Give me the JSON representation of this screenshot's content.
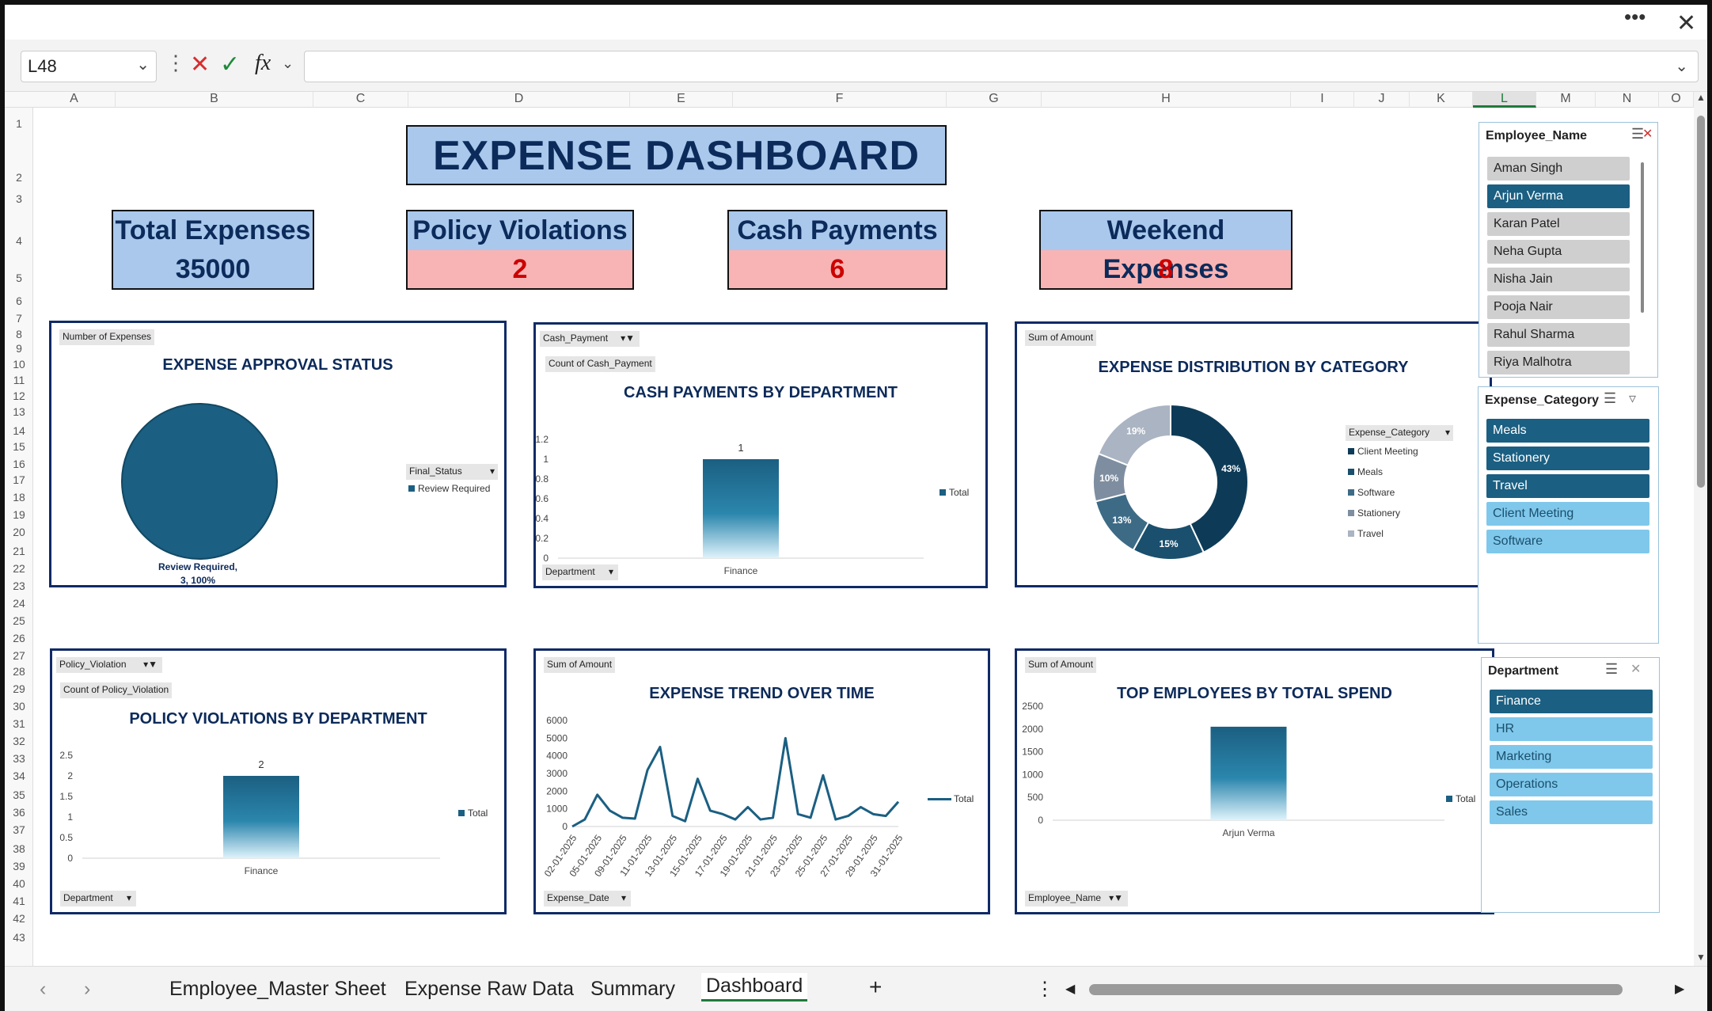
{
  "window": {
    "more": "•••",
    "close": "✕"
  },
  "formula_bar": {
    "name_box": "L48",
    "formula": "",
    "fx": "fx"
  },
  "columns": [
    "A",
    "B",
    "C",
    "D",
    "E",
    "F",
    "G",
    "H",
    "I",
    "J",
    "K",
    "L",
    "M",
    "N",
    "O"
  ],
  "selected_column": "L",
  "rows": [
    "1",
    "2",
    "3",
    "4",
    "5",
    "6",
    "7",
    "8",
    "9",
    "10",
    "11",
    "12",
    "13",
    "14",
    "15",
    "16",
    "17",
    "18",
    "19",
    "20",
    "21",
    "22",
    "23",
    "24",
    "25",
    "26",
    "27",
    "28",
    "29",
    "30",
    "31",
    "32",
    "33",
    "34",
    "35",
    "36",
    "37",
    "38",
    "39",
    "40",
    "41",
    "42",
    "43"
  ],
  "dashboard": {
    "title": "EXPENSE DASHBOARD",
    "kpis": [
      {
        "label": "Total Expenses",
        "value": "35000"
      },
      {
        "label": "Policy Violations",
        "value": "2"
      },
      {
        "label": "Cash Payments",
        "value": "6"
      },
      {
        "label": "Weekend Expenses",
        "value": "8"
      }
    ],
    "colors": {
      "primary": "#1b5f82",
      "title_fill": "#a9c8ec",
      "kpi_value_fill": "#f8b4b4",
      "kpi_value_text": "#cc0000",
      "card_border": "#0f2a66"
    }
  },
  "chart_data": [
    {
      "type": "pie",
      "title": "EXPENSE APPROVAL STATUS",
      "value_field": "Number of Expenses",
      "legend_field": "Final_Status",
      "legend_position": "right",
      "slices": [
        {
          "label": "Review Required",
          "value": 3,
          "percent": "100%"
        }
      ],
      "data_label": "Review Required,\n3, 100%"
    },
    {
      "type": "bar",
      "title": "CASH PAYMENTS BY DEPARTMENT",
      "filter_field": "Cash_Payment",
      "value_field": "Count of Cash_Payment",
      "axis_field": "Department",
      "categories": [
        "Finance"
      ],
      "series": [
        {
          "name": "Total",
          "values": [
            1
          ]
        }
      ],
      "yticks": [
        "0",
        "0.2",
        "0.4",
        "0.6",
        "0.8",
        "1",
        "1.2"
      ],
      "ylim": [
        0,
        1.2
      ],
      "data_labels": [
        "1"
      ],
      "legend_position": "right"
    },
    {
      "type": "pie",
      "title": "EXPENSE DISTRIBUTION BY CATEGORY",
      "value_field": "Sum of Amount",
      "legend_field": "Expense_Category",
      "legend_position": "right",
      "slices": [
        {
          "label": "Client Meeting",
          "percent": 43,
          "text": "43%",
          "color": "#0d3b57"
        },
        {
          "label": "Meals",
          "percent": 15,
          "text": "15%",
          "color": "#1a4f6d"
        },
        {
          "label": "Software",
          "percent": 13,
          "text": "13%",
          "color": "#3d6b86"
        },
        {
          "label": "Stationery",
          "percent": 10,
          "text": "10%",
          "color": "#7e8ea0"
        },
        {
          "label": "Travel",
          "percent": 19,
          "text": "19%",
          "color": "#aab4c2"
        }
      ]
    },
    {
      "type": "bar",
      "title": "POLICY VIOLATIONS BY DEPARTMENT",
      "filter_field": "Policy_Violation",
      "value_field": "Count of Policy_Violation",
      "axis_field": "Department",
      "categories": [
        "Finance"
      ],
      "series": [
        {
          "name": "Total",
          "values": [
            2
          ]
        }
      ],
      "yticks": [
        "0",
        "0.5",
        "1",
        "1.5",
        "2",
        "2.5"
      ],
      "ylim": [
        0,
        2.5
      ],
      "data_labels": [
        "2"
      ],
      "legend_position": "right"
    },
    {
      "type": "line",
      "title": "EXPENSE TREND OVER TIME",
      "value_field": "Sum of Amount",
      "axis_field": "Expense_Date",
      "x_labels": [
        "02-01-2025",
        "05-01-2025",
        "09-01-2025",
        "11-01-2025",
        "13-01-2025",
        "15-01-2025",
        "17-01-2025",
        "19-01-2025",
        "21-01-2025",
        "23-01-2025",
        "25-01-2025",
        "27-01-2025",
        "29-01-2025",
        "31-01-2025"
      ],
      "series": [
        {
          "name": "Total",
          "values": [
            0,
            400,
            1800,
            900,
            500,
            450,
            3200,
            4500,
            600,
            300,
            2700,
            900,
            700,
            400,
            1100,
            400,
            500,
            5000,
            700,
            500,
            2900,
            400,
            600,
            1100,
            700,
            600,
            1400
          ]
        }
      ],
      "yticks": [
        "0",
        "1000",
        "2000",
        "3000",
        "4000",
        "5000",
        "6000"
      ],
      "ylim": [
        0,
        6000
      ],
      "legend_position": "right"
    },
    {
      "type": "bar",
      "title": "TOP EMPLOYEES BY TOTAL SPEND",
      "value_field": "Sum of Amount",
      "axis_field": "Employee_Name",
      "categories": [
        "Arjun Verma"
      ],
      "series": [
        {
          "name": "Total",
          "values": [
            2050
          ]
        }
      ],
      "yticks": [
        "0",
        "500",
        "1000",
        "1500",
        "2000",
        "2500"
      ],
      "ylim": [
        0,
        2500
      ],
      "legend_position": "right"
    }
  ],
  "slicers": {
    "employee": {
      "title": "Employee_Name",
      "items": [
        "Aman Singh",
        "Arjun Verma",
        "Karan Patel",
        "Neha Gupta",
        "Nisha Jain",
        "Pooja Nair",
        "Rahul Sharma",
        "Riya Malhotra"
      ],
      "selected": [
        "Arjun Verma"
      ]
    },
    "category": {
      "title": "Expense_Category",
      "items": [
        "Meals",
        "Stationery",
        "Travel",
        "Client Meeting",
        "Software"
      ]
    },
    "department": {
      "title": "Department",
      "items": [
        "Finance",
        "HR",
        "Marketing",
        "Operations",
        "Sales"
      ],
      "selected": [
        "Finance"
      ]
    }
  },
  "sheet_tabs": {
    "tabs": [
      "Employee_Master Sheet",
      "Expense Raw Data",
      "Summary",
      "Dashboard"
    ],
    "active": "Dashboard",
    "add": "+"
  }
}
